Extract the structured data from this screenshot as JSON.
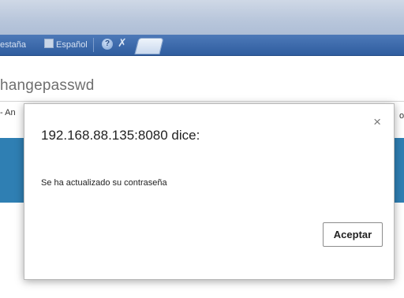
{
  "browser": {
    "tabs": [
      {
        "label": "estaña"
      },
      {
        "label": "Español"
      }
    ],
    "help_icon": "?",
    "pin_icon": "✗",
    "page_url_text": "hangepasswd",
    "page_left_text": "- An",
    "page_right_text": "o"
  },
  "dialog": {
    "title": "192.168.88.135:8080 dice:",
    "message": "Se ha actualizado su contraseña",
    "close_label": "×",
    "ok_label": "Aceptar"
  },
  "colors": {
    "tabstrip": "#2f5d9f",
    "page_band": "#2f7fb3"
  }
}
